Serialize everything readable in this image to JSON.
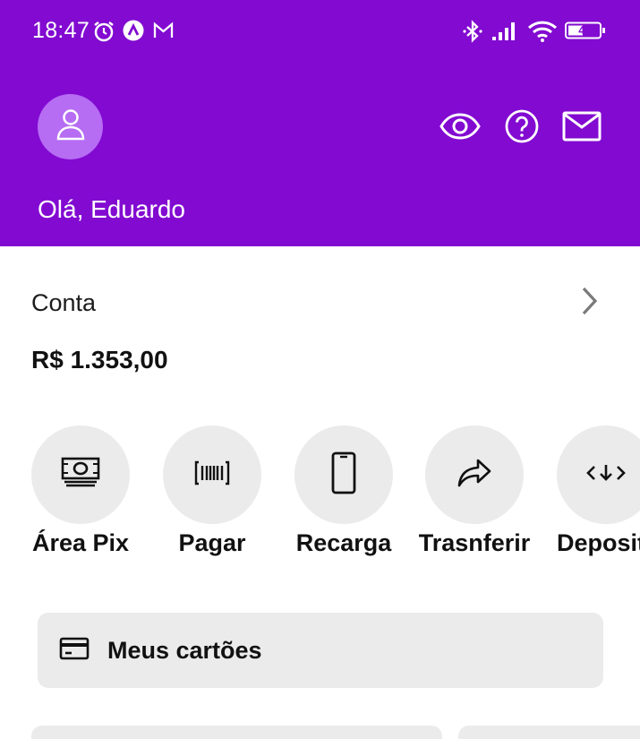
{
  "status_bar": {
    "time": "18:47",
    "battery": "41",
    "icons": [
      "alarm-icon",
      "app-notification-icon",
      "gmail-icon",
      "bluetooth-icon",
      "signal-icon",
      "wifi-icon",
      "battery-icon"
    ]
  },
  "header": {
    "greeting": "Olá, Eduardo",
    "background_color": "#820ad1",
    "icons": [
      "user-icon",
      "eye-icon",
      "help-icon",
      "mail-icon"
    ]
  },
  "account": {
    "label": "Conta",
    "balance": "R$ 1.353,00"
  },
  "actions": [
    {
      "label": "Área Pix",
      "icon": "pix-money-icon"
    },
    {
      "label": "Pagar",
      "icon": "barcode-icon"
    },
    {
      "label": "Recarga",
      "icon": "phone-icon"
    },
    {
      "label": "Trasnferir",
      "icon": "share-arrow-icon"
    },
    {
      "label": "Deposit",
      "icon": "deposit-icon"
    }
  ],
  "cards": {
    "label": "Meus cartões",
    "icon": "credit-card-icon"
  }
}
